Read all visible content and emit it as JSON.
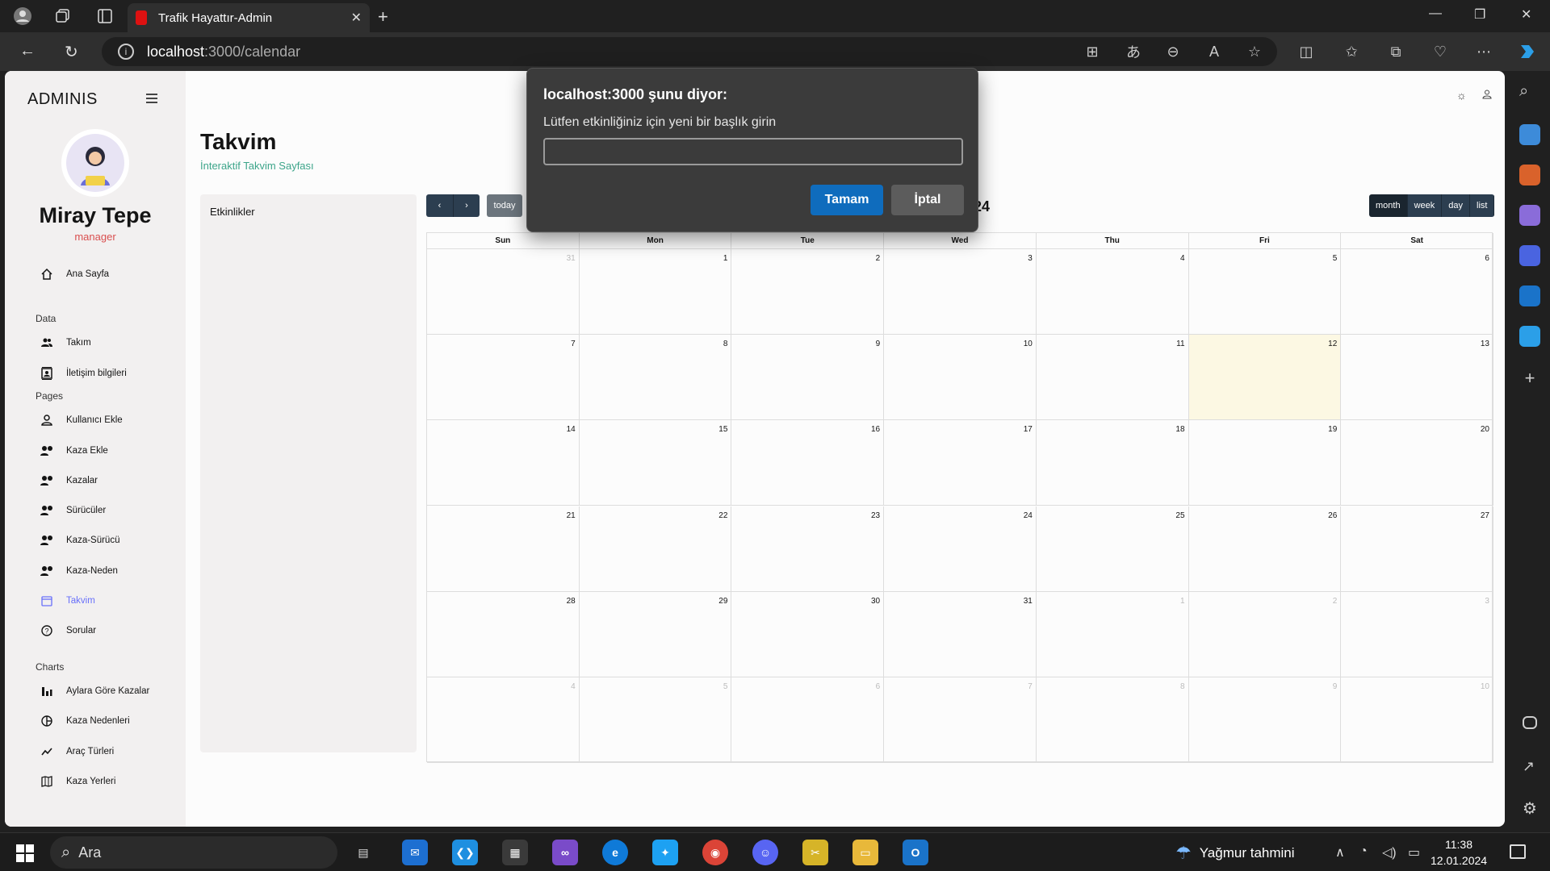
{
  "browser": {
    "tab_title": "Trafik Hayattır-Admin",
    "url_host": "localhost",
    "url_path": ":3000/calendar"
  },
  "sidebar": {
    "brand": "ADMINIS",
    "user_name": "Miray Tepe",
    "user_role": "manager",
    "sections": {
      "data": "Data",
      "pages": "Pages",
      "charts": "Charts"
    },
    "items": [
      {
        "label": "Ana Sayfa",
        "icon": "home-icon"
      },
      {
        "label": "Takım",
        "icon": "people-icon"
      },
      {
        "label": "İletişim bilgileri",
        "icon": "contacts-icon"
      },
      {
        "label": "Kullanıcı Ekle",
        "icon": "person-icon"
      },
      {
        "label": "Kaza Ekle",
        "icon": "person-pin-icon"
      },
      {
        "label": "Kazalar",
        "icon": "person-pin-icon"
      },
      {
        "label": "Sürücüler",
        "icon": "person-pin-icon"
      },
      {
        "label": "Kaza-Sürücü",
        "icon": "person-pin-icon"
      },
      {
        "label": "Kaza-Neden",
        "icon": "person-pin-icon"
      },
      {
        "label": "Takvim",
        "icon": "calendar-icon"
      },
      {
        "label": "Sorular",
        "icon": "help-icon"
      },
      {
        "label": "Aylara Göre Kazalar",
        "icon": "bar-chart-icon"
      },
      {
        "label": "Kaza Nedenleri",
        "icon": "pie-chart-icon"
      },
      {
        "label": "Araç Türleri",
        "icon": "line-chart-icon"
      },
      {
        "label": "Kaza Yerleri",
        "icon": "map-icon"
      }
    ],
    "active_item": "Takvim"
  },
  "header": {
    "title": "Takvim",
    "subtitle": "İnteraktif Takvim Sayfası"
  },
  "events_panel": {
    "label": "Etkinlikler"
  },
  "calendar": {
    "today_label": "today",
    "title_visible": "24",
    "views": [
      "month",
      "week",
      "day",
      "list"
    ],
    "active_view": "month",
    "weekdays": [
      "Sun",
      "Mon",
      "Tue",
      "Wed",
      "Thu",
      "Fri",
      "Sat"
    ],
    "weeks": [
      [
        "31",
        "1",
        "2",
        "3",
        "4",
        "5",
        "6"
      ],
      [
        "7",
        "8",
        "9",
        "10",
        "11",
        "12",
        "13"
      ],
      [
        "14",
        "15",
        "16",
        "17",
        "18",
        "19",
        "20"
      ],
      [
        "21",
        "22",
        "23",
        "24",
        "25",
        "26",
        "27"
      ],
      [
        "28",
        "29",
        "30",
        "31",
        "1",
        "2",
        "3"
      ],
      [
        "4",
        "5",
        "6",
        "7",
        "8",
        "9",
        "10"
      ]
    ],
    "today": "12"
  },
  "dialog": {
    "title": "localhost:3000 şunu diyor:",
    "message": "Lütfen etkinliğiniz için yeni bir başlık girin",
    "input_value": "",
    "ok_label": "Tamam",
    "cancel_label": "İptal"
  },
  "taskbar": {
    "search_label": "Ara",
    "weather": "Yağmur tahmini",
    "time": "11:38",
    "date": "12.01.2024"
  },
  "colors": {
    "accent": "#6870fa",
    "subtitle": "#3da58a",
    "role": "#d94f4f",
    "today_bg": "#fcf8e3",
    "dialog_ok": "#0f6cbd"
  }
}
